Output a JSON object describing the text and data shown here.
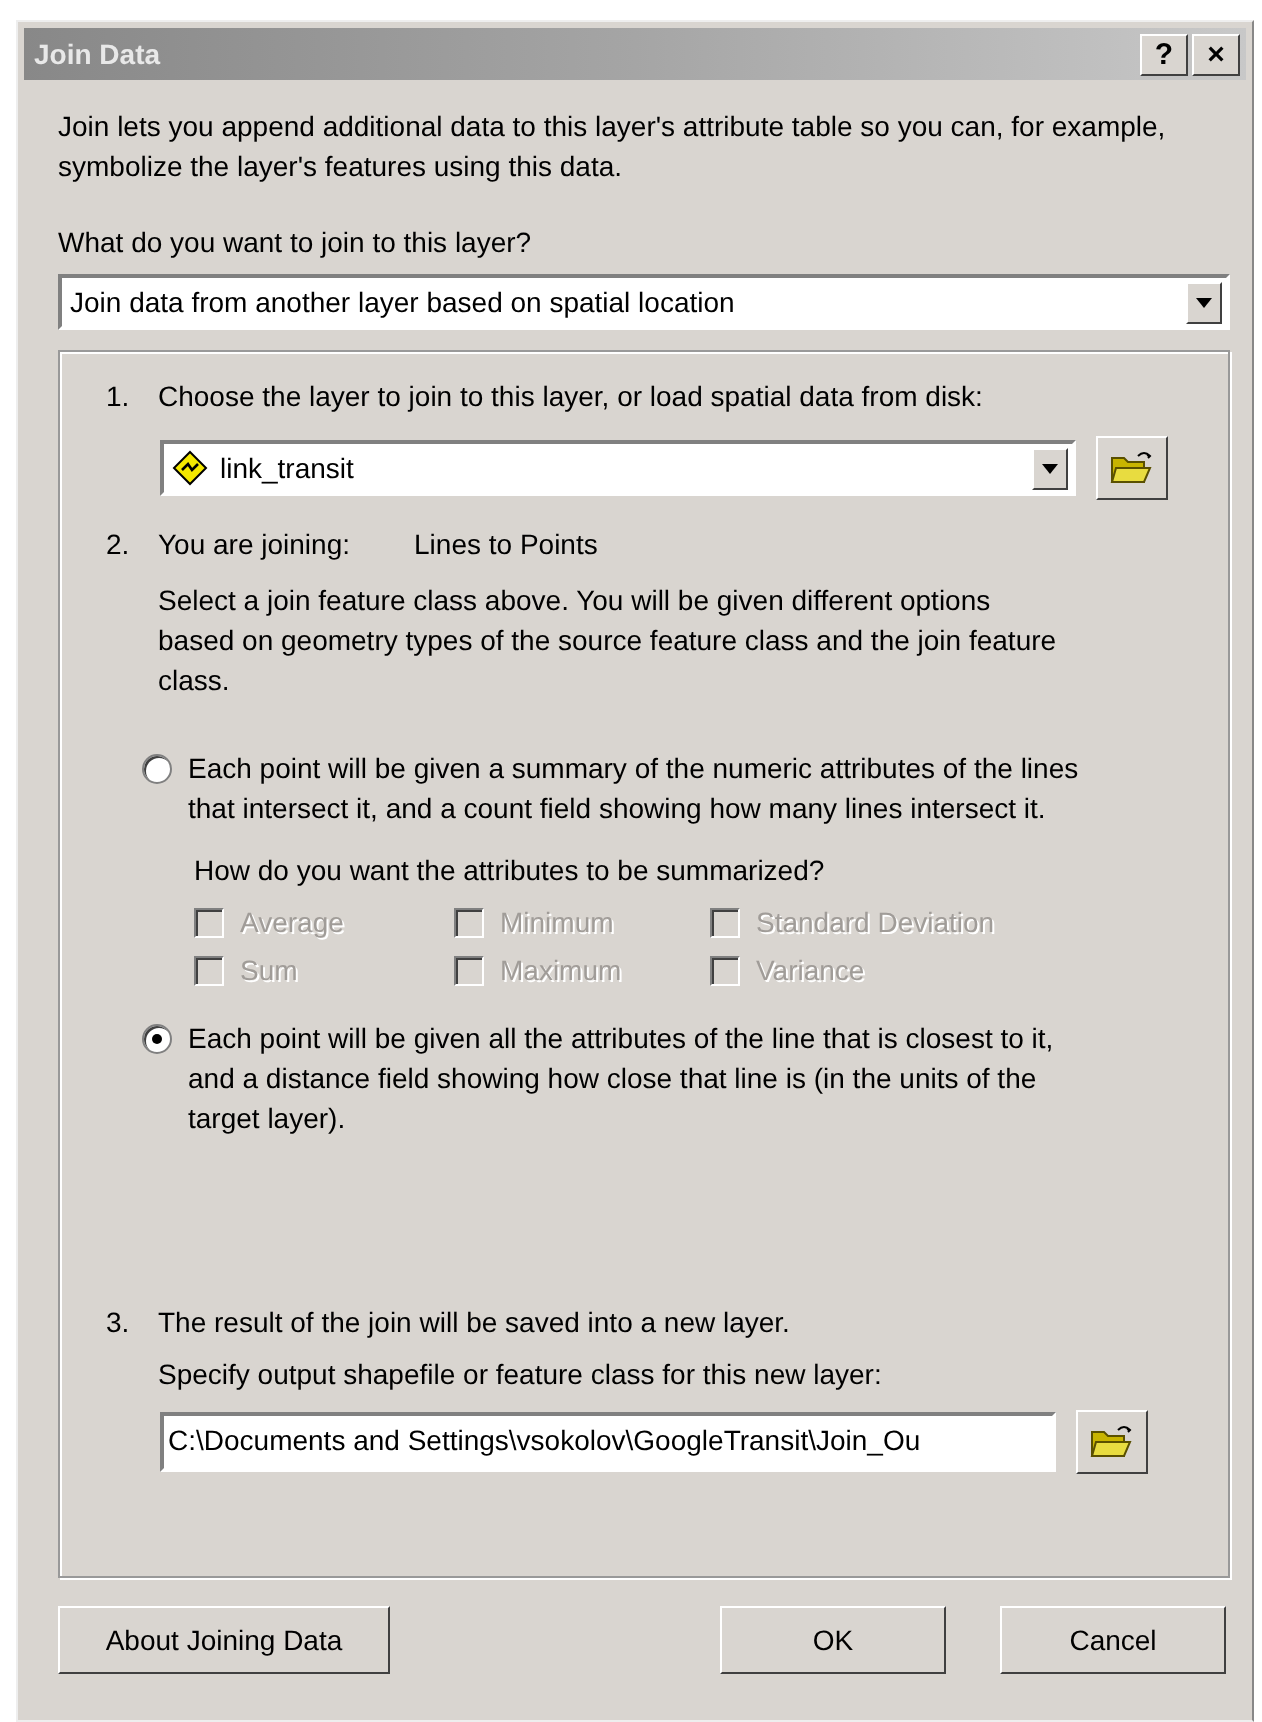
{
  "window": {
    "title": "Join Data",
    "help_button": "?",
    "close_button": "×"
  },
  "intro": "Join lets you append additional data to this layer's attribute table so you can, for example, symbolize the layer's features using this data.",
  "question": "What do you want to join to this layer?",
  "join_type": {
    "value": "Join data from another layer based on spatial location"
  },
  "step1": {
    "number": "1.",
    "label": "Choose the layer to join to this layer, or load spatial data from disk:",
    "layer": {
      "value": "link_transit"
    }
  },
  "step2": {
    "number": "2.",
    "label": "You are joining:",
    "joining": "Lines to Points",
    "description": "Select a join feature class above.  You will be given different options based on geometry types of the source feature class and the join feature class."
  },
  "options": [
    {
      "text": "Each point will be given a summary of the numeric attributes of the lines that intersect it, and a count field showing how many lines intersect it.",
      "selected": false,
      "summary_question": "How do you want the attributes to be summarized?",
      "statistics": [
        {
          "label": "Average",
          "checked": false,
          "disabled": true
        },
        {
          "label": "Minimum",
          "checked": false,
          "disabled": true
        },
        {
          "label": "Standard Deviation",
          "checked": false,
          "disabled": true
        },
        {
          "label": "Sum",
          "checked": false,
          "disabled": true
        },
        {
          "label": "Maximum",
          "checked": false,
          "disabled": true
        },
        {
          "label": "Variance",
          "checked": false,
          "disabled": true
        }
      ]
    },
    {
      "text": "Each point will be given all the attributes of the line that is closest to it, and a distance field showing how close that line is (in the units of the target layer).",
      "selected": true
    }
  ],
  "step3": {
    "number": "3.",
    "label": "The result of the join will be saved into a new layer.",
    "output_label": "Specify output shapefile or feature class for this new layer:",
    "output": {
      "value": "C:\\Documents and Settings\\vsokolov\\GoogleTransit\\Join_Ou"
    }
  },
  "buttons": [
    {
      "label": "About Joining Data"
    },
    {
      "label": "OK"
    },
    {
      "label": "Cancel"
    }
  ]
}
